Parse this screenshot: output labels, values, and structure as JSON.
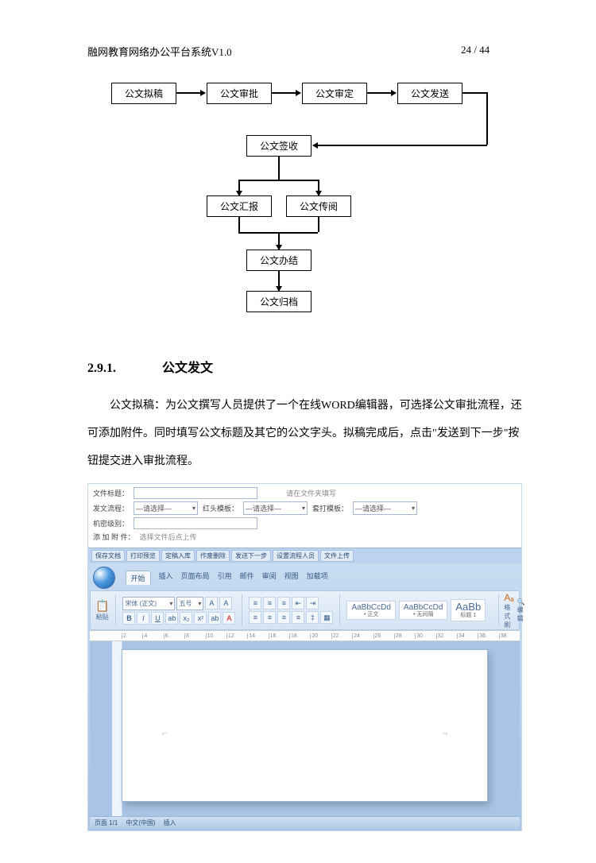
{
  "header": {
    "system_title": "融网教育网络办公平台系统V1.0",
    "page_indicator": "24 / 44"
  },
  "flowchart": {
    "r1": {
      "b1": "公文拟稿",
      "b2": "公文审批",
      "b3": "公文审定",
      "b4": "公文发送"
    },
    "r2": {
      "b1": "公文签收"
    },
    "r3": {
      "b1": "公文汇报",
      "b2": "公文传阅"
    },
    "r4": {
      "b1": "公文办结"
    },
    "r5": {
      "b1": "公文归档"
    }
  },
  "section": {
    "number": "2.9.1.",
    "title": "公文发文",
    "paragraph": "公文拟稿：为公文撰写人员提供了一个在线WORD编辑器，可选择公文审批流程，还可添加附件。同时填写公文标题及其它的公文字头。拟稿完成后，点击\"发送到下一步\"按钮提交进入审批流程。"
  },
  "screenshot": {
    "form": {
      "title_label": "文件标题：",
      "note_right": "请在文件夹填写",
      "proc_label": "发文流程：",
      "proc_ph": "—请选择—",
      "head_label": "红头模板：",
      "head_ph": "—请选择—",
      "paper_label": "套打模板：",
      "paper_ph": "—请选择—",
      "secrecy_label": "机密级别：",
      "attach_label": "添 加 附 件：",
      "attach_hint": "选择文件后点上传"
    },
    "tool_tabs": [
      "保存文档",
      "打印预览",
      "定稿入库",
      "作废删除",
      "发送下一步",
      "设置流程人员",
      "文件上传"
    ],
    "ribbon_tabs": {
      "active": "开始",
      "rest": [
        "插入",
        "页面布局",
        "引用",
        "邮件",
        "审阅",
        "视图",
        "加载项"
      ]
    },
    "styles": {
      "a": "AaBbCcDd",
      "a_sub": "• 正文",
      "b": "AaBbCcDd",
      "b_sub": "• 无间隔",
      "c": "AaBb",
      "c_sub": "标题 1"
    },
    "ribbon_right": {
      "change_style": "格式刷",
      "edit": "编辑"
    },
    "statusbar": {
      "page": "页面 1/1",
      "lang": "中文(中国)",
      "mode": "插入"
    }
  }
}
